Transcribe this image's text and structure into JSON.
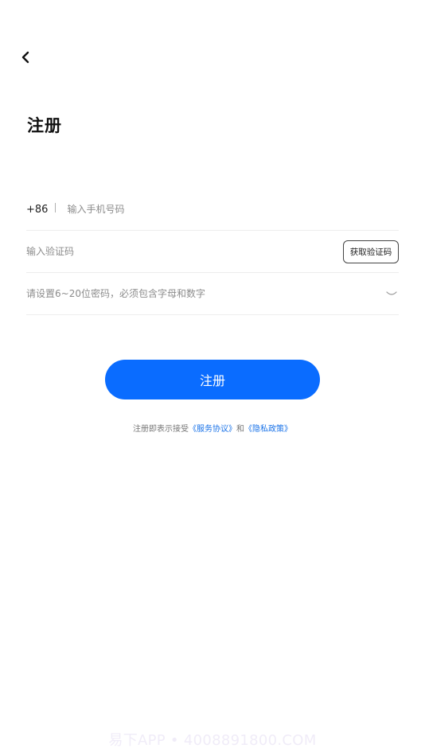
{
  "page": {
    "title": "注册"
  },
  "icons": {
    "back": "chevron-left-icon",
    "password_toggle": "eye-closed-icon"
  },
  "form": {
    "country_code": "+86",
    "phone_placeholder": "输入手机号码",
    "code_placeholder": "输入验证码",
    "get_code_label": "获取验证码",
    "password_placeholder": "请设置6~20位密码，必须包含字母和数字",
    "submit_label": "注册"
  },
  "agreement": {
    "prefix": "注册即表示接受",
    "service_link": "《服务协议》",
    "conjunction": "和",
    "privacy_link": "《隐私政策》"
  },
  "watermark": {
    "text": "易下APP • 4008891800.COM"
  },
  "colors": {
    "primary": "#0A6CFF",
    "link": "#1A73E8"
  }
}
